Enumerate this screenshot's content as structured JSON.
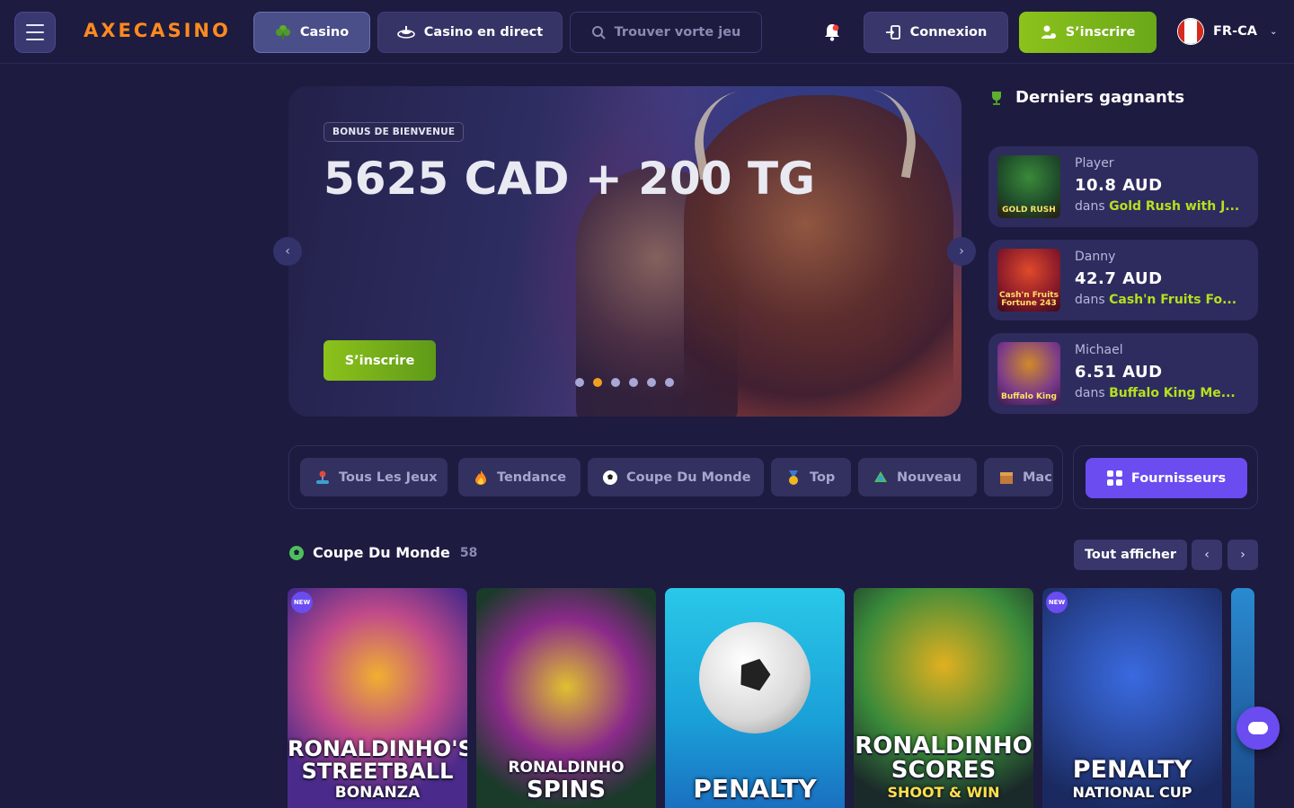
{
  "header": {
    "logo": "AXECASINO",
    "nav": {
      "casino": "Casino",
      "live": "Casino en direct",
      "search_placeholder": "Trouver vorte jeu"
    },
    "login": "Connexion",
    "signup": "S’inscrire",
    "language": "FR-CA"
  },
  "hero": {
    "badge": "BONUS DE BIENVENUE",
    "title": "5625 CAD + 200 TG",
    "cta": "S’inscrire",
    "slides": 6,
    "active_slide": 2
  },
  "winners": {
    "title": "Derniers gagnants",
    "prefix": "dans",
    "items": [
      {
        "name": "Player",
        "amount": "10.8 AUD",
        "game": "Gold Rush with J...",
        "thumb": "GOLD RUSH"
      },
      {
        "name": "Danny",
        "amount": "42.7 AUD",
        "game": "Cash'n Fruits Fo...",
        "thumb": "Cash'n Fruits Fortune 243"
      },
      {
        "name": "Michael",
        "amount": "6.51 AUD",
        "game": "Buffalo King Me...",
        "thumb": "Buffalo King"
      }
    ]
  },
  "categories": [
    {
      "label": "Tous Les Jeux",
      "icon": "joystick-icon"
    },
    {
      "label": "Tendance",
      "icon": "fire-icon"
    },
    {
      "label": "Coupe Du Monde",
      "icon": "soccer-ball-icon"
    },
    {
      "label": "Top",
      "icon": "medal-icon"
    },
    {
      "label": "Nouveau",
      "icon": "new-icon"
    },
    {
      "label": "Mac",
      "icon": "box-icon"
    }
  ],
  "providers": "Fournisseurs",
  "section": {
    "title": "Coupe Du Monde",
    "count": "58",
    "show_all": "Tout afficher"
  },
  "games": [
    {
      "line1": "RONALDINHO'S",
      "line2": "STREETBALL",
      "line3": "BONANZA",
      "new": true,
      "badge": "NEW"
    },
    {
      "line1": "",
      "line2": "RONALDINHO",
      "line3": "SPINS",
      "new": false,
      "badge": ""
    },
    {
      "line1": "",
      "line2": "",
      "line3": "PENALTY",
      "new": false,
      "badge": ""
    },
    {
      "line1": "RONALDINHO",
      "line2": "SCORES",
      "line3": "SHOOT & WIN",
      "new": false,
      "badge": ""
    },
    {
      "line1": "",
      "line2": "PENALTY",
      "line3": "NATIONAL CUP",
      "new": true,
      "badge": "NEW"
    }
  ],
  "colors": {
    "background": "#1d1b3f",
    "accent_green": "#8cc21b",
    "accent_purple": "#6a4cf0",
    "highlight_lime": "#b6e01e",
    "logo_orange": "#ff8a1f"
  }
}
